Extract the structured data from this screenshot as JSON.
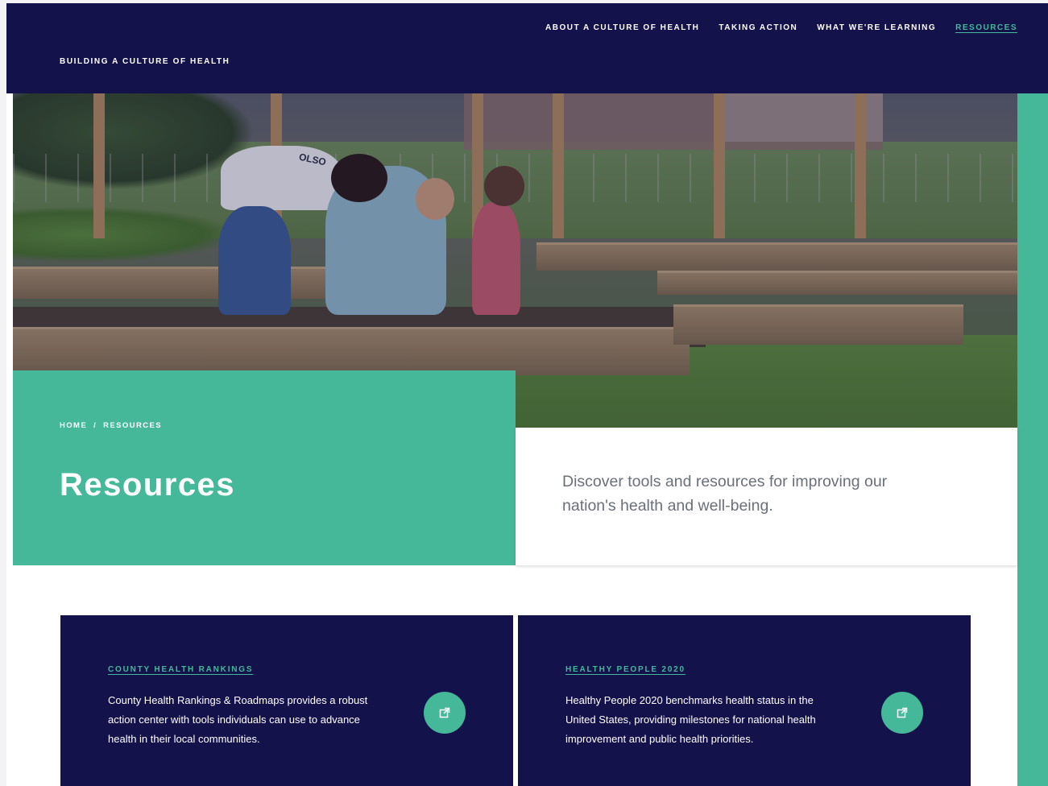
{
  "header": {
    "brand": "BUILDING A CULTURE OF HEALTH",
    "nav": [
      {
        "label": "ABOUT A CULTURE OF HEALTH"
      },
      {
        "label": "TAKING ACTION"
      },
      {
        "label": "WHAT WE'RE LEARNING"
      },
      {
        "label": "RESOURCES",
        "active": true
      }
    ]
  },
  "hero": {
    "shirt_text": "OLSO"
  },
  "page": {
    "breadcrumb": {
      "home": "HOME",
      "separator": "/",
      "current": "RESOURCES"
    },
    "title": "Resources",
    "description": "Discover tools and resources for improving our nation's health and well-being."
  },
  "cards": [
    {
      "title": "COUNTY HEALTH RANKINGS",
      "text": "County Health Rankings & Roadmaps provides a robust action center with tools individuals can use to advance health in their local communities.",
      "icon": "external-link-icon"
    },
    {
      "title": "HEALTHY PEOPLE 2020",
      "text": "Healthy People 2020 benchmarks health status in the United States, providing milestones for national health improvement and public health priorities.",
      "icon": "external-link-icon"
    }
  ],
  "colors": {
    "navy": "#14124a",
    "teal": "#45b89a",
    "text_gray": "#6b6f7a"
  }
}
